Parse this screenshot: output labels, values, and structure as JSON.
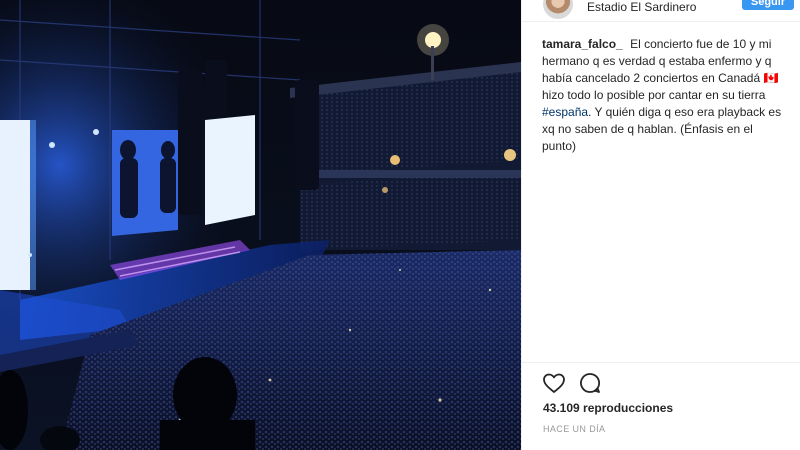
{
  "post": {
    "location": "Estadio El Sardinero",
    "follow_label": "Seguir"
  },
  "caption": {
    "username": "tamara_falco_",
    "text_part1": "El concierto fue de 10 y mi hermano q es verdad q estaba enfermo y q había cancelado 2 conciertos en Canadá",
    "text_emoji": "🇨🇦",
    "text_part2": "hizo todo lo posible por cantar en su tierra",
    "hashtag": "#españa",
    "text_part3": ". Y quién diga q eso era playback es xq no saben de q hablan. (Énfasis en el punto)"
  },
  "actions": {
    "like_icon": "heart-icon",
    "comment_icon": "comment-bubble-icon",
    "views": "43.109 reproducciones",
    "timestamp": "HACE UN DÍA"
  }
}
